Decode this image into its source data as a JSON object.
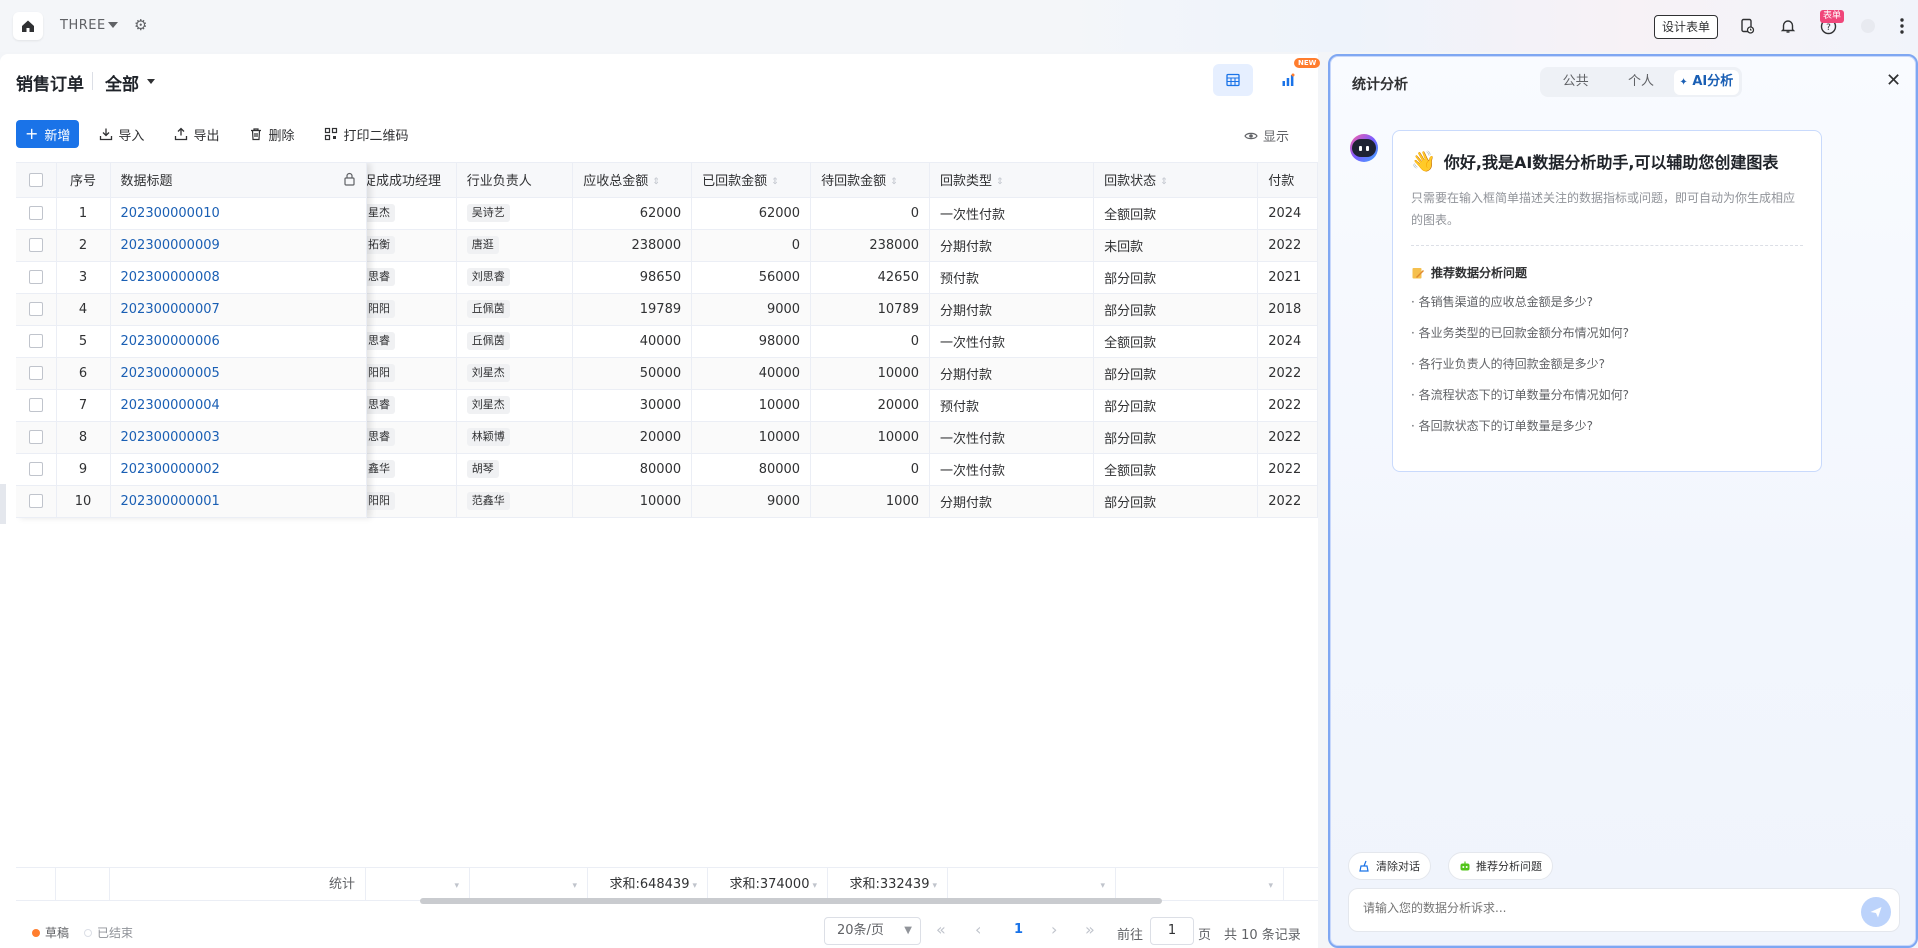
{
  "topbar": {
    "app_name": "THREE",
    "design_btn": "设计表单",
    "badge": "表单"
  },
  "header": {
    "title": "销售订单",
    "view": "全部",
    "new_tag": "NEW"
  },
  "toolbar": {
    "add": "新增",
    "import": "导入",
    "export": "导出",
    "delete": "删除",
    "print_qr": "打印二维码",
    "display": "显示"
  },
  "table": {
    "columns": [
      "序号",
      "数据标题",
      "促成成功经理",
      "行业负责人",
      "应收总金额",
      "已回款金额",
      "待回款金额",
      "回款类型",
      "回款状态",
      "付款"
    ],
    "rows": [
      {
        "no": "1",
        "title": "202300000010",
        "manager": "星杰",
        "owner": "吴诗艺",
        "receivable": "62000",
        "received": "62000",
        "pending": "0",
        "type": "一次性付款",
        "status": "全额回款",
        "pay": "2024"
      },
      {
        "no": "2",
        "title": "202300000009",
        "manager": "拓衡",
        "owner": "唐逛",
        "receivable": "238000",
        "received": "0",
        "pending": "238000",
        "type": "分期付款",
        "status": "未回款",
        "pay": "2022"
      },
      {
        "no": "3",
        "title": "202300000008",
        "manager": "思睿",
        "owner": "刘思睿",
        "receivable": "98650",
        "received": "56000",
        "pending": "42650",
        "type": "预付款",
        "status": "部分回款",
        "pay": "2021"
      },
      {
        "no": "4",
        "title": "202300000007",
        "manager": "阳阳",
        "owner": "丘佩茵",
        "receivable": "19789",
        "received": "9000",
        "pending": "10789",
        "type": "分期付款",
        "status": "部分回款",
        "pay": "2018"
      },
      {
        "no": "5",
        "title": "202300000006",
        "manager": "思睿",
        "owner": "丘佩茵",
        "receivable": "40000",
        "received": "98000",
        "pending": "0",
        "type": "一次性付款",
        "status": "全额回款",
        "pay": "2024"
      },
      {
        "no": "6",
        "title": "202300000005",
        "manager": "阳阳",
        "owner": "刘星杰",
        "receivable": "50000",
        "received": "40000",
        "pending": "10000",
        "type": "分期付款",
        "status": "部分回款",
        "pay": "2022"
      },
      {
        "no": "7",
        "title": "202300000004",
        "manager": "思睿",
        "owner": "刘星杰",
        "receivable": "30000",
        "received": "10000",
        "pending": "20000",
        "type": "预付款",
        "status": "部分回款",
        "pay": "2022"
      },
      {
        "no": "8",
        "title": "202300000003",
        "manager": "思睿",
        "owner": "林颖博",
        "receivable": "20000",
        "received": "10000",
        "pending": "10000",
        "type": "一次性付款",
        "status": "部分回款",
        "pay": "2022"
      },
      {
        "no": "9",
        "title": "202300000002",
        "manager": "鑫华",
        "owner": "胡琴",
        "receivable": "80000",
        "received": "80000",
        "pending": "0",
        "type": "一次性付款",
        "status": "全额回款",
        "pay": "2022"
      },
      {
        "no": "10",
        "title": "202300000001",
        "manager": "阳阳",
        "owner": "范鑫华",
        "receivable": "10000",
        "received": "9000",
        "pending": "1000",
        "type": "分期付款",
        "status": "部分回款",
        "pay": "2022"
      }
    ],
    "footer": {
      "label": "统计",
      "sum_receivable": "求和:648439",
      "sum_received": "求和:374000",
      "sum_pending": "求和:332439"
    }
  },
  "status_legend": {
    "draft": "草稿",
    "ended": "已结束"
  },
  "pagination": {
    "page_size": "20条/页",
    "current": "1",
    "goto_label": "前往",
    "goto_value": "1",
    "page_unit": "页",
    "total": "共 10 条记录"
  },
  "ai_panel": {
    "title": "统计分析",
    "tabs": [
      "公共",
      "个人",
      "AI分析"
    ],
    "greeting": "你好,我是AI数据分析助手,可以辅助您创建图表",
    "intro": "只需要在输入框简单描述关注的数据指标或问题，即可自动为你生成相应的图表。",
    "rec_title": "推荐数据分析问题",
    "questions": [
      "· 各销售渠道的应收总金额是多少?",
      "· 各业务类型的已回款金额分布情况如何?",
      "· 各行业负责人的待回款金额是多少?",
      "· 各流程状态下的订单数量分布情况如何?",
      "· 各回款状态下的订单数量是多少?"
    ],
    "clear_btn": "清除对话",
    "recommend_btn": "推荐分析问题",
    "input_placeholder": "请输入您的数据分析诉求..."
  },
  "colors": {
    "accent": "#1a73e8",
    "draft_dot": "#ff7d2e",
    "link": "#1a5fb4"
  }
}
